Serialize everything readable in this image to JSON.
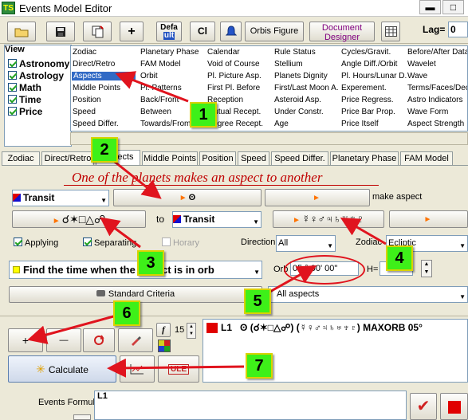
{
  "window": {
    "title": "Events Model Editor",
    "app_icon": "TS",
    "minimize": "▬",
    "maximize": "□"
  },
  "toolbar": {
    "default_line1": "Defa",
    "default_line2": "ult",
    "cl": "Cl",
    "orbis": "Orbis Figure",
    "doc_line1": "Document",
    "doc_line2": "Designer",
    "lag_label": "Lag=",
    "lag_value": "0"
  },
  "view": {
    "title": "View",
    "items": [
      {
        "label": "Astronomy",
        "checked": true
      },
      {
        "label": "Astrology",
        "checked": true
      },
      {
        "label": "Math",
        "checked": true
      },
      {
        "label": "Time",
        "checked": true
      },
      {
        "label": "Price",
        "checked": true
      }
    ]
  },
  "grid": {
    "columns": [
      [
        "Zodiac",
        "Direct/Retro",
        "Aspects",
        "Middle Points",
        "Position",
        "Speed",
        "Speed Differ."
      ],
      [
        "Planetary Phase",
        "FAM Model",
        "Orbit",
        "Pl. Patterns",
        "Back/Front",
        "Between",
        "Towards/From"
      ],
      [
        "Calendar",
        "Void of Course",
        "Pl. Picture Asp.",
        "First Pl. Before",
        "Reception",
        "Mutual Recept.",
        "Degree Recept."
      ],
      [
        "Rule Status",
        "Stellium",
        "Planets Dignity",
        "First/Last Moon A.",
        "Asteroid Asp.",
        "Under Constr.",
        "Age"
      ],
      [
        "Cycles/Gravit.",
        "Angle Diff./Orbit",
        "Pl. Hours/Lunar D.",
        "Experement.",
        "Price Regress.",
        "Price Bar Prop.",
        "Price Itself"
      ],
      [
        "Before/After Data",
        "Wavelet",
        "Wave",
        "Terms/Faces/Deca",
        "Astro Indicators",
        "Wave Form",
        "Aspect Strength"
      ]
    ],
    "selected": "Aspects"
  },
  "tabs": [
    "Zodiac",
    "Direct/Retro",
    "Aspects",
    "Middle Points",
    "Position",
    "Speed",
    "Speed Differ.",
    "Planetary Phase",
    "FAM Model"
  ],
  "aspect_form": {
    "heading": "One of the planets makes an aspect to another",
    "transit1": "Transit",
    "planet1": "ʘ",
    "make_aspect": "make aspect",
    "aspects": "☌✶□△☍",
    "to": "to",
    "transit2": "Transit",
    "planets2": "☿♀♂♃♄♅♆♇",
    "applying": "Applying",
    "separating": "Separating",
    "horary": "Horary",
    "direction_label": "Direction",
    "direction_value": "All",
    "zodiac_label": "Zodiac",
    "zodiac_value": "Ecliptic",
    "find_time": "Find the time when the aspect is in orb",
    "orb_label": "Orb",
    "orb_value": "05 ° 00' 00\"",
    "h_label": "H=",
    "standard_criteria": "Standard Criteria",
    "all_aspects": "All aspects"
  },
  "bottom": {
    "plus": "+",
    "minus": "—",
    "f_label": "f",
    "spin_value": "15",
    "calculate": "Calculate",
    "ule": "ULE",
    "list_item_id": "L1",
    "list_item_text": "ʘ (☌✶□△☍) (☿♀♂♃♄♅♆♇) MAXORB 05°",
    "formula_label": "Events Formula",
    "formula_value": "L1"
  },
  "annotations": [
    "1",
    "2",
    "3",
    "4",
    "5",
    "6",
    "7"
  ],
  "colors": {
    "badge": "#3ef019",
    "arrow": "#e0141e",
    "heading": "#c00000",
    "selection": "#316ac5"
  }
}
